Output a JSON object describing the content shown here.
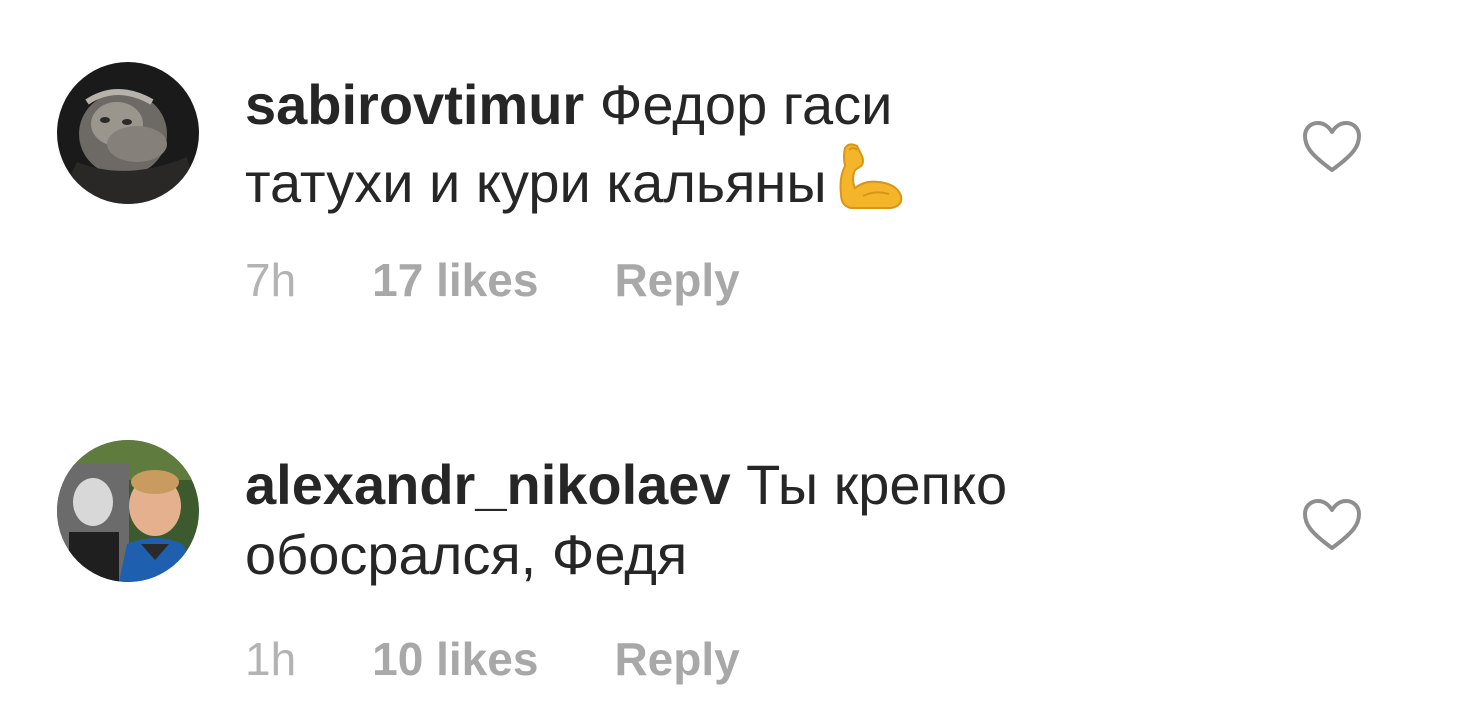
{
  "comments": [
    {
      "username": "sabirovtimur",
      "text_line1": " Федор гаси",
      "text_line2": "татухи и кури кальяны",
      "emoji": "flexed-biceps",
      "time": "7h",
      "likes": "17 likes",
      "reply": "Reply",
      "like_icon": "heart-outline-icon"
    },
    {
      "username": "alexandr_nikolaev",
      "text_line1": " Ты крепко",
      "text_line2": "обосрался, Федя",
      "time": "1h",
      "likes": "10 likes",
      "reply": "Reply",
      "like_icon": "heart-outline-icon"
    }
  ],
  "colors": {
    "text": "#262626",
    "meta": "#a8a8a8",
    "icon": "#8e8e8e",
    "background": "#ffffff"
  }
}
